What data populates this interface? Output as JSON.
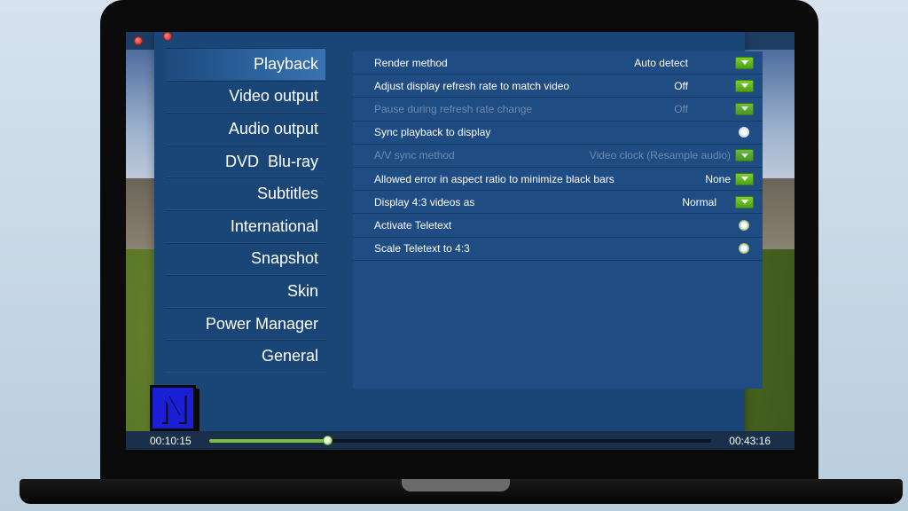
{
  "sidebar": {
    "items": [
      {
        "label": "Playback",
        "active": true
      },
      {
        "label": "Video output",
        "active": false
      },
      {
        "label": "Audio output",
        "active": false
      },
      {
        "label": "DVD  Blu-ray",
        "active": false
      },
      {
        "label": "Subtitles",
        "active": false
      },
      {
        "label": "International",
        "active": false
      },
      {
        "label": "Snapshot",
        "active": false
      },
      {
        "label": "Skin",
        "active": false
      },
      {
        "label": "Power Manager",
        "active": false
      },
      {
        "label": "General",
        "active": false
      }
    ]
  },
  "settings": {
    "rows": [
      {
        "label": "Render method",
        "value": "Auto detect",
        "control": "dropdown",
        "enabled": true
      },
      {
        "label": "Adjust display refresh rate to match video",
        "value": "Off",
        "control": "dropdown",
        "enabled": true
      },
      {
        "label": "Pause during refresh rate change",
        "value": "Off",
        "control": "dropdown",
        "enabled": false
      },
      {
        "label": "Sync playback to display",
        "value": "",
        "control": "radio",
        "enabled": true
      },
      {
        "label": "A/V sync method",
        "value": "Video clock (Resample audio)",
        "control": "dropdown",
        "enabled": false
      },
      {
        "label": "Allowed error in aspect ratio to minimize black bars",
        "value": "None",
        "control": "dropdown",
        "enabled": true
      },
      {
        "label": "Display 4:3 videos as",
        "value": "Normal",
        "control": "dropdown",
        "enabled": true
      },
      {
        "label": "Activate Teletext",
        "value": "",
        "control": "radio",
        "enabled": true
      },
      {
        "label": "Scale Teletext to 4:3",
        "value": "",
        "control": "radio",
        "enabled": true
      }
    ]
  },
  "player": {
    "elapsed": "00:10:15",
    "duration": "00:43:16",
    "progress_fraction": 0.237
  },
  "logo": {
    "letter": "N"
  },
  "colors": {
    "accent_green": "#6ab82a",
    "panel_blue": "#1f4c83",
    "dialog_blue": "#1a4577"
  }
}
